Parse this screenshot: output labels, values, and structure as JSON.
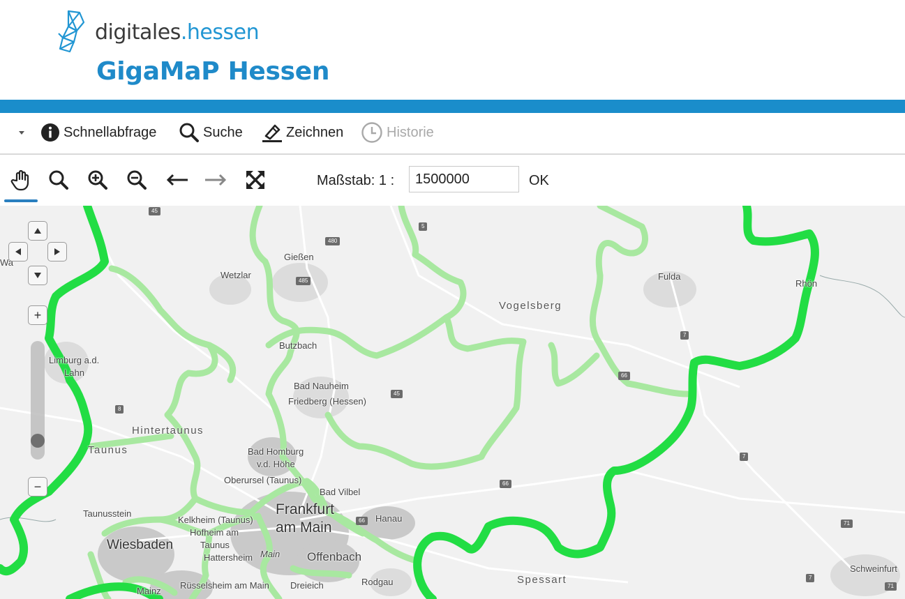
{
  "header": {
    "logo_text_main": "digitales",
    "logo_text_dot": ".",
    "logo_text_accent": "hessen",
    "app_title": "GigaMaP Hessen",
    "brand_color": "#1a8dcb"
  },
  "menu": {
    "items": [
      {
        "label": "Schnellabfrage",
        "icon": "info-icon",
        "enabled": true
      },
      {
        "label": "Suche",
        "icon": "search-icon",
        "enabled": true
      },
      {
        "label": "Zeichnen",
        "icon": "pen-icon",
        "enabled": true
      },
      {
        "label": "Historie",
        "icon": "history-icon",
        "enabled": false
      }
    ],
    "dropdown_icon": "caret-down-icon"
  },
  "toolbar": {
    "tools": [
      "pan-hand-icon",
      "zoom-box-icon",
      "zoom-in-icon",
      "zoom-out-icon",
      "back-arrow-icon",
      "forward-arrow-icon",
      "full-extent-icon"
    ],
    "active_tool": "pan-hand-icon",
    "scale_label": "Maßstab: 1 :",
    "scale_value": "1500000",
    "ok_label": "OK"
  },
  "map": {
    "labels": {
      "giessen": "Gießen",
      "wetzlar": "Wetzlar",
      "fulda": "Fulda",
      "vogelsberg": "Vogelsberg",
      "butzbach": "Butzbach",
      "limburg1": "Limburg a.d.",
      "limburg2": "Lahn",
      "bad_nauheim": "Bad Nauheim",
      "friedberg": "Friedberg (Hessen)",
      "hintertaunus": "Hintertaunus",
      "taunus": "Taunus",
      "bad_homburg1": "Bad Homburg",
      "bad_homburg2": "v.d. Höhe",
      "oberursel": "Oberursel (Taunus)",
      "bad_vilbel": "Bad Vilbel",
      "frankfurt1": "Frankfurt",
      "frankfurt2": "am Main",
      "hanau": "Hanau",
      "taunusstein": "Taunusstein",
      "kelkheim": "Kelkheim (Taunus)",
      "hofheim": "Hofheim am",
      "taunus_small": "Taunus",
      "hattersheim": "Hattersheim",
      "main": "Main",
      "wiesbaden": "Wiesbaden",
      "offenbach": "Offenbach",
      "dreieich": "Dreieich",
      "rodgau": "Rodgau",
      "spessart": "Spessart",
      "schweinfurt": "Schweinfurt",
      "rhoen": "Rhön",
      "mainz": "Mainz",
      "russelsheim": "Rüsselsheim am Main",
      "wa": "Wa"
    },
    "road_shields": [
      "45",
      "5",
      "480",
      "485",
      "7",
      "45",
      "66",
      "8",
      "66",
      "7",
      "66",
      "71",
      "7",
      "71"
    ],
    "nav": {
      "pan_up_icon": "arrow-up-icon",
      "pan_left_icon": "arrow-left-icon",
      "pan_right_icon": "arrow-right-icon",
      "pan_down_icon": "arrow-down-icon",
      "zoom_in": "+",
      "zoom_out": "−"
    },
    "colors": {
      "outer_border": "#22dd44",
      "inner_border": "#a8e8a0",
      "urban": "#c9c9c9"
    }
  }
}
